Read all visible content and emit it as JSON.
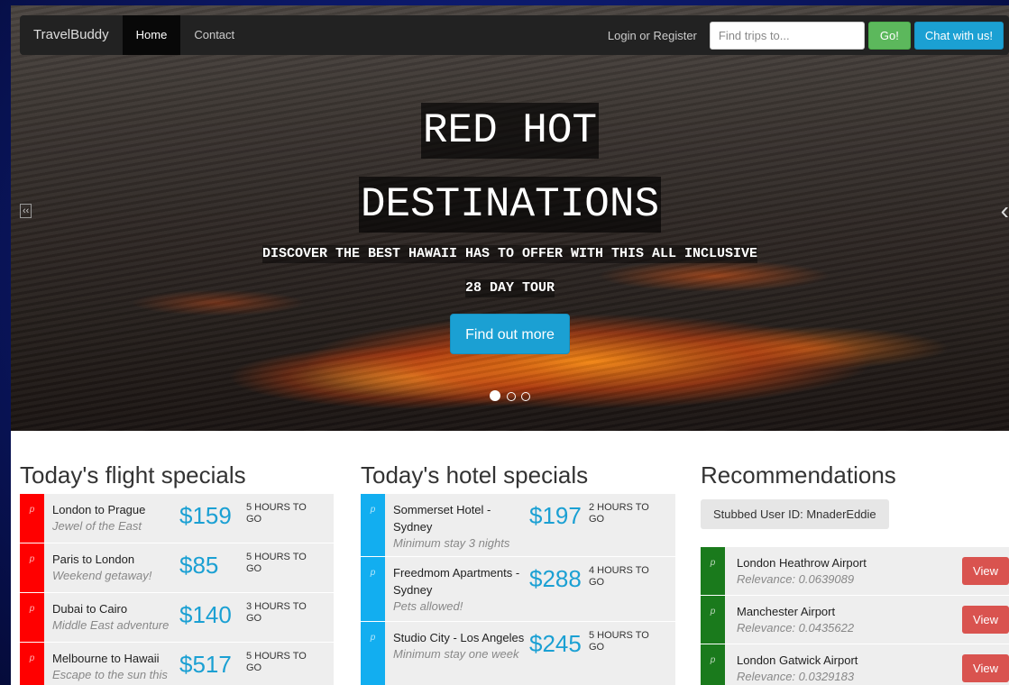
{
  "nav": {
    "brand": "TravelBuddy",
    "home": "Home",
    "contact": "Contact",
    "login": "Login or Register",
    "search_placeholder": "Find trips to...",
    "go": "Go!",
    "chat": "Chat with us!"
  },
  "hero": {
    "headline_line1": "RED HOT",
    "headline_line2": "DESTINATIONS",
    "subtitle_line1": "DISCOVER THE BEST HAWAII HAS TO OFFER WITH THIS ALL INCLUSIVE",
    "subtitle_line2": "28 DAY TOUR",
    "button": "Find out more",
    "active_slide": 1,
    "slide_count": 3
  },
  "flights": {
    "heading": "Today's flight specials",
    "items": [
      {
        "icon": "p",
        "title": "London to Prague",
        "subtitle": "Jewel of the East",
        "price": "$159",
        "time": "5 HOURS TO GO"
      },
      {
        "icon": "p",
        "title": "Paris to London",
        "subtitle": "Weekend getaway!",
        "price": "$85",
        "time": "5 HOURS TO GO"
      },
      {
        "icon": "p",
        "title": "Dubai to Cairo",
        "subtitle": "Middle East adventure",
        "price": "$140",
        "time": "3 HOURS TO GO"
      },
      {
        "icon": "p",
        "title": "Melbourne to Hawaii",
        "subtitle": "Escape to the sun this",
        "price": "$517",
        "time": "5 HOURS TO GO"
      }
    ]
  },
  "hotels": {
    "heading": "Today's hotel specials",
    "items": [
      {
        "icon": "p",
        "title": "Sommerset Hotel - Sydney",
        "subtitle": "Minimum stay 3 nights",
        "price": "$197",
        "time": "2 HOURS TO GO"
      },
      {
        "icon": "p",
        "title": "Freedmom Apartments - Sydney",
        "subtitle": "Pets allowed!",
        "price": "$288",
        "time": "4 HOURS TO GO"
      },
      {
        "icon": "p",
        "title": "Studio City - Los Angeles",
        "subtitle": "Minimum stay one week",
        "price": "$245",
        "time": "5 HOURS TO GO"
      }
    ]
  },
  "recommendations": {
    "heading": "Recommendations",
    "user": "Stubbed User ID: MnaderEddie",
    "view_label": "View",
    "items": [
      {
        "icon": "p",
        "title": "London Heathrow Airport",
        "subtitle": "Relevance: 0.0639089"
      },
      {
        "icon": "p",
        "title": "Manchester Airport",
        "subtitle": "Relevance: 0.0435622"
      },
      {
        "icon": "p",
        "title": "London Gatwick Airport",
        "subtitle": "Relevance: 0.0329183"
      }
    ]
  },
  "colors": {
    "flight_stripe": "#ff0000",
    "hotel_stripe": "#12aef0",
    "rec_stripe": "#1a7a1c",
    "price": "#1ba0d3",
    "view_button": "#d9534f",
    "go_button": "#5cb85c"
  }
}
